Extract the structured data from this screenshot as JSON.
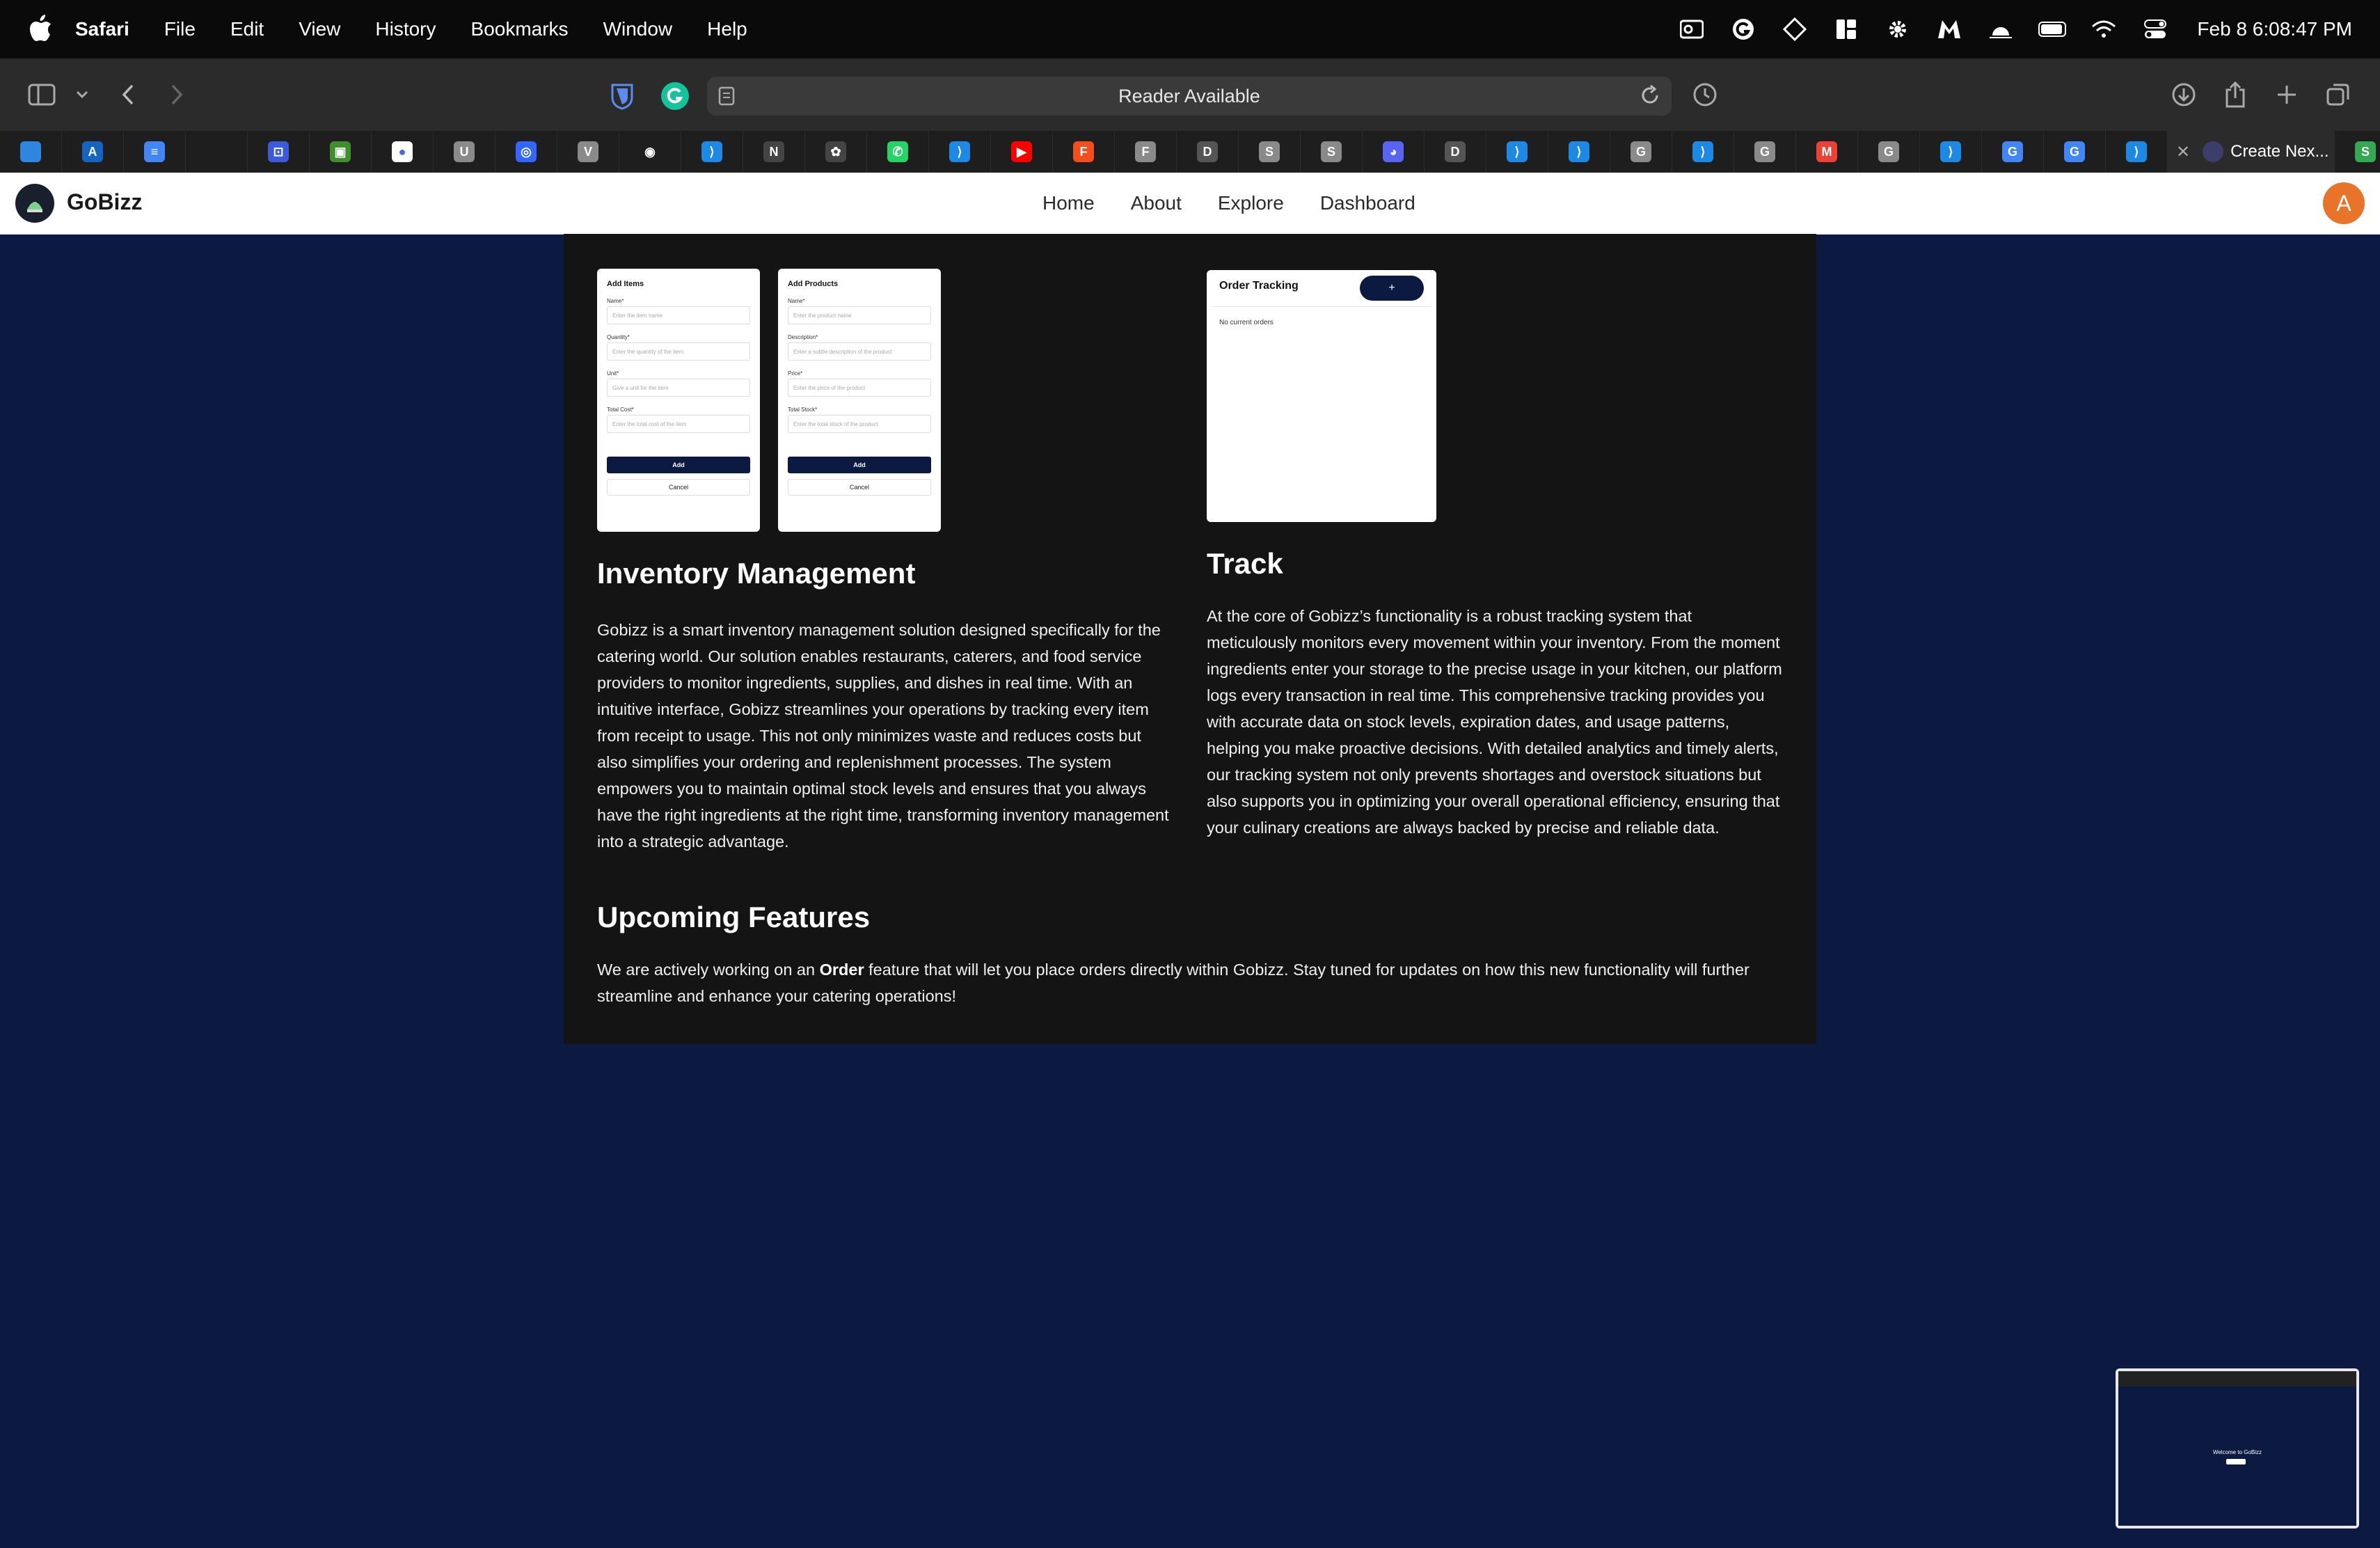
{
  "menubar": {
    "app_name": "Safari",
    "menus": [
      "File",
      "Edit",
      "View",
      "History",
      "Bookmarks",
      "Window",
      "Help"
    ],
    "clock": "Feb 8  6:08:47 PM",
    "status_icons": [
      "outlook-icon",
      "grammarly-icon",
      "diamond-icon",
      "layout-icon",
      "gear-icon",
      "malwarebytes-icon",
      "brightness-icon",
      "battery-icon",
      "wifi-icon",
      "control-center-icon"
    ]
  },
  "toolbar": {
    "address_text": "Reader Available"
  },
  "tabs": {
    "favicons": [
      {
        "name": "play-icon",
        "letter": "",
        "color": "#2e86de"
      },
      {
        "name": "arc-icon",
        "letter": "A",
        "color": "#1565c0"
      },
      {
        "name": "docs-icon",
        "letter": "≡",
        "color": "#4285f4"
      },
      {
        "name": "blank-icon",
        "letter": "",
        "color": "#1e1e1e"
      },
      {
        "name": "grid-icon",
        "letter": "⊡",
        "color": "#3b5bdb"
      },
      {
        "name": "minecraft-icon",
        "letter": "▣",
        "color": "#3f8f2f"
      },
      {
        "name": "record-icon",
        "letter": "●",
        "color": "#ffffff"
      },
      {
        "name": "u-icon",
        "letter": "U",
        "color": "#8a8a8a"
      },
      {
        "name": "target-icon",
        "letter": "◎",
        "color": "#3366ff"
      },
      {
        "name": "v-icon",
        "letter": "V",
        "color": "#8a8a8a"
      },
      {
        "name": "github-icon",
        "letter": "◉",
        "color": "#1e1e1e"
      },
      {
        "name": "vscode-icon",
        "letter": "⟩",
        "color": "#1e88e5"
      },
      {
        "name": "notion-icon",
        "letter": "N",
        "color": "#444444"
      },
      {
        "name": "openai-icon",
        "letter": "✿",
        "color": "#444444"
      },
      {
        "name": "whatsapp-icon",
        "letter": "✆",
        "color": "#25d366"
      },
      {
        "name": "vscode-icon",
        "letter": "⟩",
        "color": "#1e88e5"
      },
      {
        "name": "youtube-icon",
        "letter": "▶",
        "color": "#ff0000"
      },
      {
        "name": "figma-icon",
        "letter": "F",
        "color": "#f24e1e"
      },
      {
        "name": "f-icon",
        "letter": "F",
        "color": "#8a8a8a"
      },
      {
        "name": "d-icon",
        "letter": "D",
        "color": "#555555"
      },
      {
        "name": "s-icon",
        "letter": "S",
        "color": "#8a8a8a"
      },
      {
        "name": "s-icon",
        "letter": "S",
        "color": "#8a8a8a"
      },
      {
        "name": "discord-icon",
        "letter": "◕",
        "color": "#5865f2"
      },
      {
        "name": "d-icon",
        "letter": "D",
        "color": "#555555"
      },
      {
        "name": "vscode-icon",
        "letter": "⟩",
        "color": "#1e88e5"
      },
      {
        "name": "vscode-icon",
        "letter": "⟩",
        "color": "#1e88e5"
      },
      {
        "name": "g-icon",
        "letter": "G",
        "color": "#8a8a8a"
      },
      {
        "name": "vscode-icon",
        "letter": "⟩",
        "color": "#1e88e5"
      },
      {
        "name": "g-icon",
        "letter": "G",
        "color": "#8a8a8a"
      },
      {
        "name": "gmail-icon",
        "letter": "M",
        "color": "#ea4335"
      },
      {
        "name": "g-icon",
        "letter": "G",
        "color": "#8a8a8a"
      },
      {
        "name": "vscode-icon",
        "letter": "⟩",
        "color": "#1e88e5"
      },
      {
        "name": "google-icon",
        "letter": "G",
        "color": "#4285f4"
      },
      {
        "name": "google-icon",
        "letter": "G",
        "color": "#4285f4"
      },
      {
        "name": "vscode-icon",
        "letter": "⟩",
        "color": "#1e88e5"
      }
    ],
    "active_tab": "Create Nex..."
  },
  "site": {
    "brand": "GoBizz",
    "nav": [
      "Home",
      "About",
      "Explore",
      "Dashboard"
    ],
    "avatar_letter": "A",
    "accent_color": "#0c1a42",
    "avatar_color": "#e8742a"
  },
  "mock_add_items": {
    "title": "Add Items",
    "fields": [
      {
        "label": "Name*",
        "placeholder": "Enter the item name"
      },
      {
        "label": "Quantity*",
        "placeholder": "Enter the quantity of the item"
      },
      {
        "label": "Unit*",
        "placeholder": "Give a unit for the item"
      },
      {
        "label": "Total Cost*",
        "placeholder": "Enter the total cost of the item"
      }
    ],
    "add": "Add",
    "cancel": "Cancel"
  },
  "mock_add_products": {
    "title": "Add Products",
    "fields": [
      {
        "label": "Name*",
        "placeholder": "Enter the product name"
      },
      {
        "label": "Description*",
        "placeholder": "Enter a subtle description of the product"
      },
      {
        "label": "Price*",
        "placeholder": "Enter the price of the product"
      },
      {
        "label": "Total Stock*",
        "placeholder": "Enter the total stock of the product"
      }
    ],
    "add": "Add",
    "cancel": "Cancel"
  },
  "mock_order": {
    "title": "Order Tracking",
    "plus": "+",
    "empty": "No current orders"
  },
  "inventory": {
    "heading": "Inventory Management",
    "body": "Gobizz is a smart inventory management solution designed specifically for the catering world. Our solution enables restaurants, caterers, and food service providers to monitor ingredients, supplies, and dishes in real time. With an intuitive interface, Gobizz streamlines your operations by tracking every item from receipt to usage. This not only minimizes waste and reduces costs but also simplifies your ordering and replenishment processes. The system empowers you to maintain optimal stock levels and ensures that you always have the right ingredients at the right time, transforming inventory management into a strategic advantage."
  },
  "track": {
    "heading": "Track",
    "body": "At the core of Gobizz’s functionality is a robust tracking system that meticulously monitors every movement within your inventory. From the moment ingredients enter your storage to the precise usage in your kitchen, our platform logs every transaction in real time. This comprehensive tracking provides you with accurate data on stock levels, expiration dates, and usage patterns, helping you make proactive decisions. With detailed analytics and timely alerts, our tracking system not only prevents shortages and overstock situations but also supports you in optimizing your overall operational efficiency, ensuring that your culinary creations are always backed by precise and reliable data."
  },
  "upcoming": {
    "heading": "Upcoming Features",
    "body_before": "We are actively working on an ",
    "body_bold": "Order",
    "body_after": " feature that will let you place orders directly within Gobizz. Stay tuned for updates on how this new functionality will further streamline and enhance your catering operations!"
  },
  "thumbnail": {
    "text": "Welcome to GoBizz"
  }
}
